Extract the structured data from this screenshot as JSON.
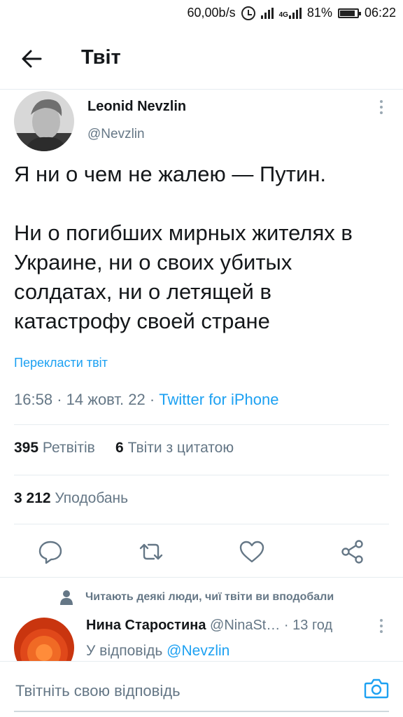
{
  "status_bar": {
    "speed": "60,00b/s",
    "network": "4G",
    "battery": "81%",
    "time": "06:22"
  },
  "header": {
    "title": "Твіт",
    "back_icon": "arrow-left-icon"
  },
  "tweet": {
    "author_name": "Leonid Nevzlin",
    "author_handle": "@Nevzlin",
    "text_line1": "Я ни о чем не жалею — Путин.",
    "text_line2": "Ни о погибших мирных жителях в Украине, ни о своих убитых солдатах, ни о летящей в катастрофу своей стране",
    "translate_label": "Перекласти твіт",
    "time": "16:58",
    "date": "14 жовт. 22",
    "source": "Twitter for iPhone",
    "retweets_count": "395",
    "retweets_label": "Ретвітів",
    "quotes_count": "6",
    "quotes_label": "Твіти з цитатою",
    "likes_count": "3 212",
    "likes_label": "Уподобань"
  },
  "actions": [
    "reply-icon",
    "retweet-icon",
    "like-icon",
    "share-icon"
  ],
  "social_context": "Читають деякі люди, чиї твіти ви вподобали",
  "reply": {
    "name": "Нина Старостина",
    "handle": "@NinaSt…",
    "age": "13 год",
    "replying_prefix": "У відповідь",
    "replying_to": "@Nevzlin"
  },
  "composer": {
    "placeholder": "Твітніть свою відповідь"
  },
  "colors": {
    "accent": "#1da1f2",
    "text": "#14171a",
    "secondary": "#657786",
    "divider": "#e6ecf0"
  }
}
